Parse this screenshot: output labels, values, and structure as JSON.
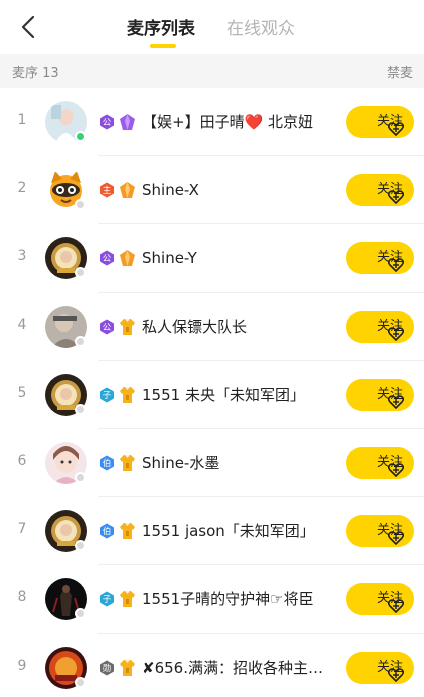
{
  "header": {
    "tabs": [
      {
        "label": "麦序列表",
        "active": true
      },
      {
        "label": "在线观众",
        "active": false
      }
    ]
  },
  "subheader": {
    "queue_label": "麦序 13",
    "ban_label": "禁麦"
  },
  "follow_label": "关注",
  "colors": {
    "accent": "#ffd300",
    "online": "#3ad07a"
  },
  "rows": [
    {
      "index": "1",
      "name": "【娱+】田子晴❤️ 北京妞",
      "badge1": "公",
      "badge1_color": "#8a4de0",
      "badge2": "purple-crystal-icon",
      "online": true
    },
    {
      "index": "2",
      "name": "Shine-X",
      "badge1": "主",
      "badge1_color": "#f05a32",
      "badge2": "orange-crystal-icon",
      "online": false
    },
    {
      "index": "3",
      "name": "Shine-Y",
      "badge1": "公",
      "badge1_color": "#8a4de0",
      "badge2": "orange-crystal-icon",
      "online": false
    },
    {
      "index": "4",
      "name": "私人保镖大队长",
      "badge1": "公",
      "badge1_color": "#8a4de0",
      "badge2": "yellow-shirt-icon",
      "online": false
    },
    {
      "index": "5",
      "name": "1551 未央「未知军团」",
      "badge1": "子",
      "badge1_color": "#29a8d8",
      "badge2": "yellow-shirt-icon",
      "online": false
    },
    {
      "index": "6",
      "name": "Shine-水墨",
      "badge1": "伯",
      "badge1_color": "#3c8df0",
      "badge2": "yellow-shirt-icon",
      "online": false
    },
    {
      "index": "7",
      "name": "1551 jason「未知军团」",
      "badge1": "伯",
      "badge1_color": "#3c8df0",
      "badge2": "yellow-shirt-icon",
      "online": false
    },
    {
      "index": "8",
      "name": "1551子晴的守护神☞将臣",
      "badge1": "子",
      "badge1_color": "#29a8d8",
      "badge2": "yellow-shirt-icon",
      "online": false
    },
    {
      "index": "9",
      "name": "✘656.满满：招收各种主…",
      "badge1": "勋",
      "badge1_color": "#6b6b6b",
      "badge2": "yellow-shirt-icon",
      "online": false
    }
  ]
}
